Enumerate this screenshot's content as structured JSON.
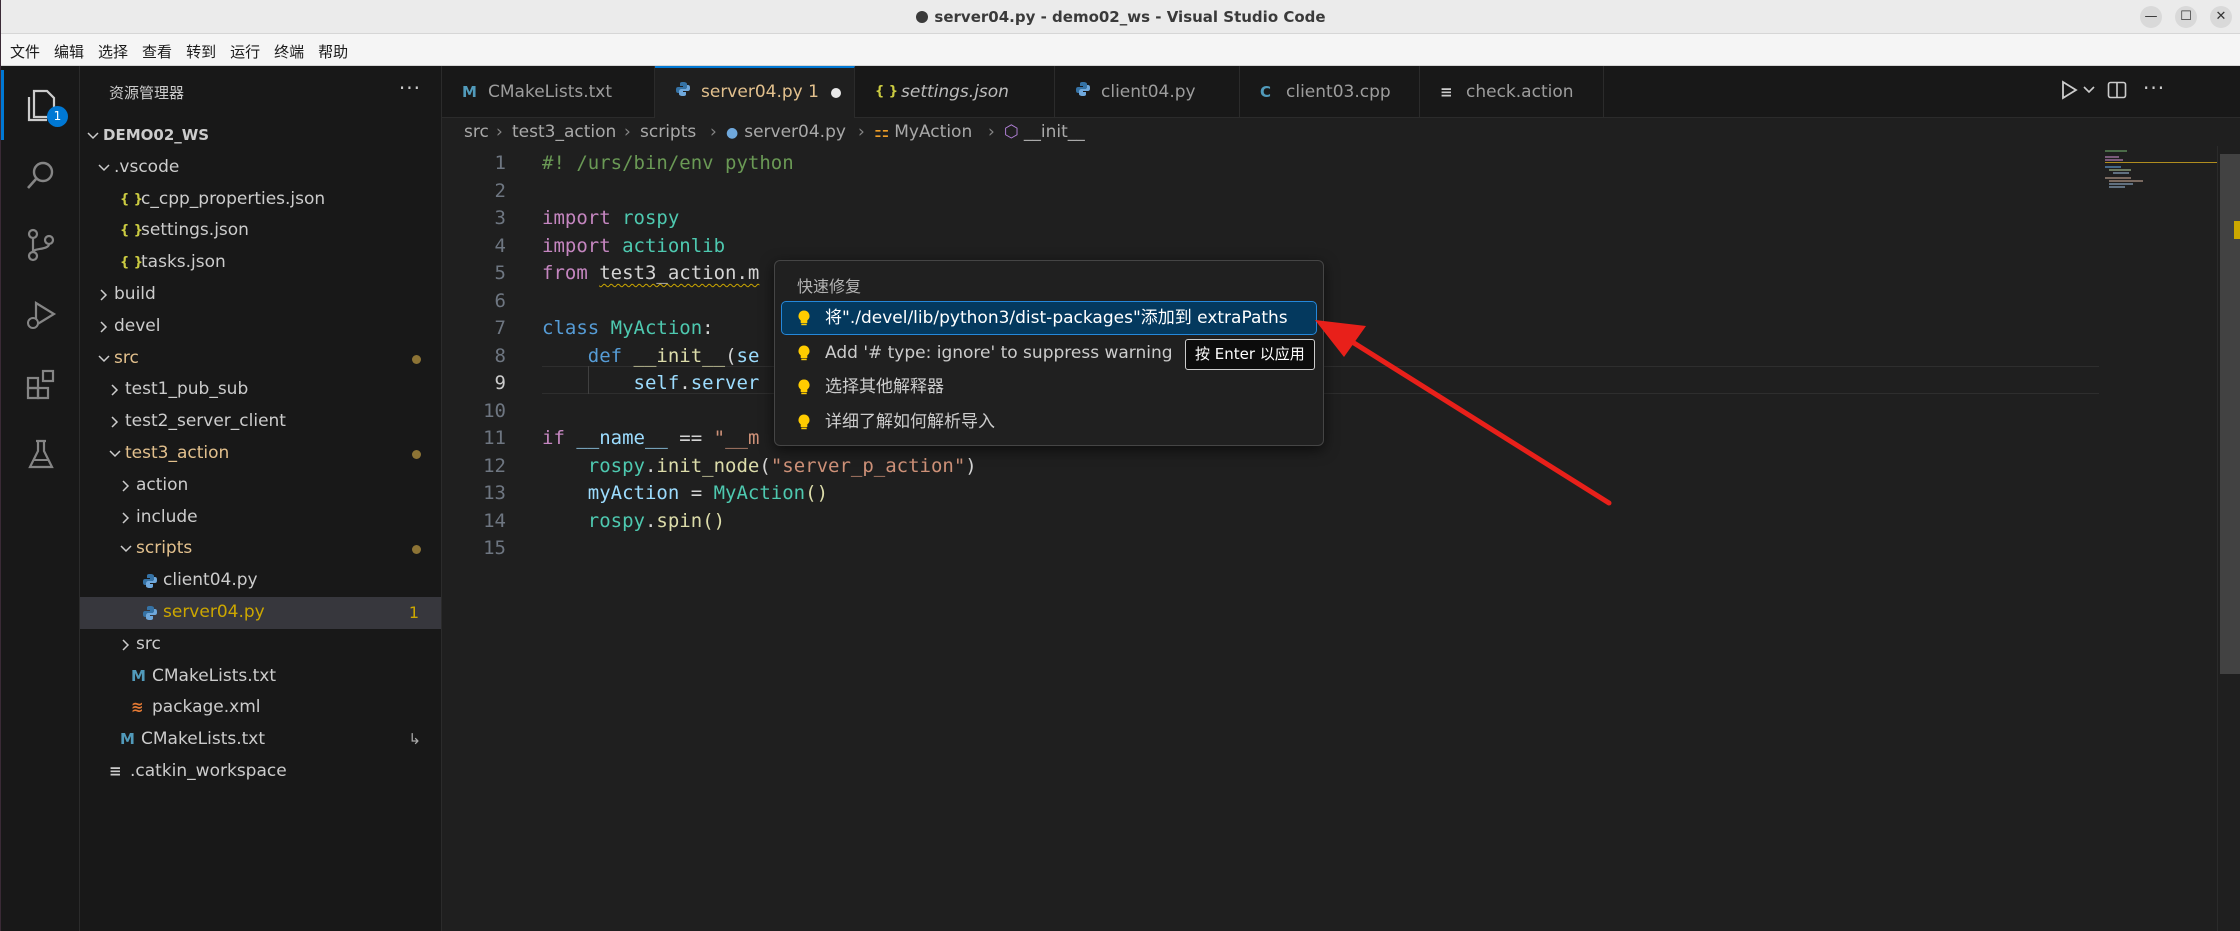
{
  "window": {
    "title": "server04.py - demo02_ws - Visual Studio Code",
    "minimize": "—",
    "maximize": "☐",
    "close": "✕"
  },
  "menu": [
    "文件",
    "编辑",
    "选择",
    "查看",
    "转到",
    "运行",
    "终端",
    "帮助"
  ],
  "activity_bar": {
    "explorer_badge": "1",
    "icons": [
      "explorer-icon",
      "search-icon",
      "source-control-icon",
      "run-debug-icon",
      "extensions-icon",
      "testing-icon"
    ]
  },
  "sidebar": {
    "title": "资源管理器",
    "more": "···",
    "items": [
      {
        "label": "DEMO02_WS",
        "depth": 0,
        "type": "folder",
        "open": true,
        "bold": true
      },
      {
        "label": ".vscode",
        "depth": 1,
        "type": "folder",
        "open": true
      },
      {
        "label": "c_cpp_properties.json",
        "depth": 2,
        "type": "json"
      },
      {
        "label": "settings.json",
        "depth": 2,
        "type": "json"
      },
      {
        "label": "tasks.json",
        "depth": 2,
        "type": "json"
      },
      {
        "label": "build",
        "depth": 1,
        "type": "folder",
        "open": false
      },
      {
        "label": "devel",
        "depth": 1,
        "type": "folder",
        "open": false
      },
      {
        "label": "src",
        "depth": 1,
        "type": "folder",
        "open": true,
        "modified": true
      },
      {
        "label": "test1_pub_sub",
        "depth": 2,
        "type": "folder",
        "open": false
      },
      {
        "label": "test2_server_client",
        "depth": 2,
        "type": "folder",
        "open": false
      },
      {
        "label": "test3_action",
        "depth": 2,
        "type": "folder",
        "open": true,
        "modified": true
      },
      {
        "label": "action",
        "depth": 3,
        "type": "folder",
        "open": false
      },
      {
        "label": "include",
        "depth": 3,
        "type": "folder",
        "open": false
      },
      {
        "label": "scripts",
        "depth": 3,
        "type": "folder",
        "open": true,
        "modified": true
      },
      {
        "label": "client04.py",
        "depth": 4,
        "type": "python"
      },
      {
        "label": "server04.py",
        "depth": 4,
        "type": "python",
        "selected": true,
        "count": "1"
      },
      {
        "label": "src",
        "depth": 3,
        "type": "folder",
        "open": false
      },
      {
        "label": "CMakeLists.txt",
        "depth": 3,
        "type": "cmake"
      },
      {
        "label": "package.xml",
        "depth": 3,
        "type": "xml"
      },
      {
        "label": "CMakeLists.txt",
        "depth": 2,
        "type": "cmake",
        "link": "↳"
      },
      {
        "label": ".catkin_workspace",
        "depth": 1,
        "type": "text"
      }
    ]
  },
  "tabs": [
    {
      "label": "CMakeLists.txt",
      "icon": "cmake"
    },
    {
      "label": "server04.py 1",
      "icon": "python",
      "active": true,
      "dirty": true
    },
    {
      "label": "settings.json",
      "icon": "json",
      "italic": true
    },
    {
      "label": "client04.py",
      "icon": "python"
    },
    {
      "label": "client03.cpp",
      "icon": "cpp"
    },
    {
      "label": "check.action",
      "icon": "text"
    }
  ],
  "breadcrumb": [
    "src",
    "test3_action",
    "scripts",
    "server04.py",
    "MyAction",
    "__init__"
  ],
  "editor": {
    "current_line": 9,
    "lines": [
      {
        "n": "1",
        "tokens": [
          [
            "cmt",
            "#! /urs/bin/env python"
          ]
        ]
      },
      {
        "n": "2",
        "tokens": []
      },
      {
        "n": "3",
        "tokens": [
          [
            "ctl",
            "import"
          ],
          [
            "plain",
            " "
          ],
          [
            "cls",
            "rospy"
          ]
        ]
      },
      {
        "n": "4",
        "tokens": [
          [
            "ctl",
            "import"
          ],
          [
            "plain",
            " "
          ],
          [
            "cls",
            "actionlib"
          ]
        ]
      },
      {
        "n": "5",
        "tokens": [
          [
            "ctl",
            "from"
          ],
          [
            "plain",
            " "
          ],
          [
            "squig",
            "test3_action.m"
          ]
        ]
      },
      {
        "n": "6",
        "tokens": []
      },
      {
        "n": "7",
        "tokens": [
          [
            "kw",
            "class"
          ],
          [
            "plain",
            " "
          ],
          [
            "cls",
            "MyAction"
          ],
          [
            "plain",
            ":"
          ]
        ]
      },
      {
        "n": "8",
        "tokens": [
          [
            "plain",
            "    "
          ],
          [
            "kw",
            "def"
          ],
          [
            "plain",
            " "
          ],
          [
            "fn",
            "__init__"
          ],
          [
            "plain",
            "("
          ],
          [
            "var",
            "se"
          ]
        ]
      },
      {
        "n": "9",
        "tokens": [
          [
            "plain",
            "        "
          ],
          [
            "var",
            "self"
          ],
          [
            "plain",
            "."
          ],
          [
            "var",
            "server"
          ]
        ]
      },
      {
        "n": "10",
        "tokens": []
      },
      {
        "n": "11",
        "tokens": [
          [
            "ctl",
            "if"
          ],
          [
            "plain",
            " "
          ],
          [
            "var",
            "__name__"
          ],
          [
            "plain",
            " == "
          ],
          [
            "str",
            "\"__m"
          ]
        ]
      },
      {
        "n": "12",
        "tokens": [
          [
            "plain",
            "    "
          ],
          [
            "cls",
            "rospy"
          ],
          [
            "plain",
            "."
          ],
          [
            "fn",
            "init_node"
          ],
          [
            "plain",
            "("
          ],
          [
            "str",
            "\"server_p_action\""
          ],
          [
            "plain",
            ")"
          ]
        ]
      },
      {
        "n": "13",
        "tokens": [
          [
            "plain",
            "    "
          ],
          [
            "var",
            "myAction"
          ],
          [
            "plain",
            " = "
          ],
          [
            "cls",
            "MyAction"
          ],
          [
            "fn",
            "()"
          ]
        ]
      },
      {
        "n": "14",
        "tokens": [
          [
            "plain",
            "    "
          ],
          [
            "cls",
            "rospy"
          ],
          [
            "plain",
            "."
          ],
          [
            "fn",
            "spin"
          ],
          [
            "fn",
            "()"
          ]
        ]
      },
      {
        "n": "15",
        "tokens": []
      }
    ]
  },
  "quick_fix": {
    "title": "快速修复",
    "items": [
      "将\"./devel/lib/python3/dist-packages\"添加到 extraPaths",
      "Add '# type: ignore' to suppress warning",
      "选择其他解释器",
      "详细了解如何解析导入"
    ],
    "selected_index": 0,
    "hint": "按 Enter 以应用"
  },
  "colors": {
    "accent": "#0078d4",
    "warning": "#cca700",
    "annotation_arrow": "#e8201a",
    "bulb": "#ffcc00"
  }
}
